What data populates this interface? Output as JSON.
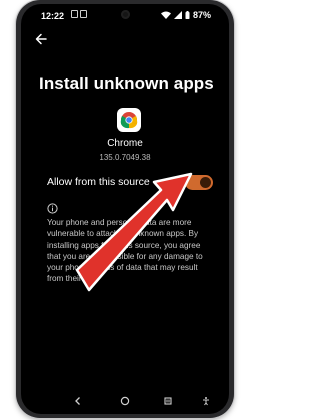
{
  "status_bar": {
    "time": "12:22",
    "battery": "87%",
    "icons": [
      "notification-icon",
      "notification-icon",
      "wifi-icon",
      "signal-icon",
      "battery-icon"
    ]
  },
  "header": {
    "back_icon": "back-arrow-icon",
    "title": "Install unknown apps"
  },
  "app": {
    "name": "Chrome",
    "version": "135.0.7049.38",
    "icon": "chrome-icon"
  },
  "setting": {
    "label": "Allow from this source",
    "enabled": true,
    "accent_color": "#d06a2e"
  },
  "warning": {
    "icon": "info-icon",
    "text": "Your phone and personal data are more vulnerable to attack by unknown apps. By installing apps from this source, you agree that you are responsible for any damage to your phone or loss of data that may result from their use."
  },
  "annotation": {
    "type": "pointer-arrow",
    "color": "#e0322b"
  },
  "nav_bar": {
    "buttons": [
      "back-icon",
      "home-icon",
      "recents-icon",
      "accessibility-icon"
    ]
  }
}
